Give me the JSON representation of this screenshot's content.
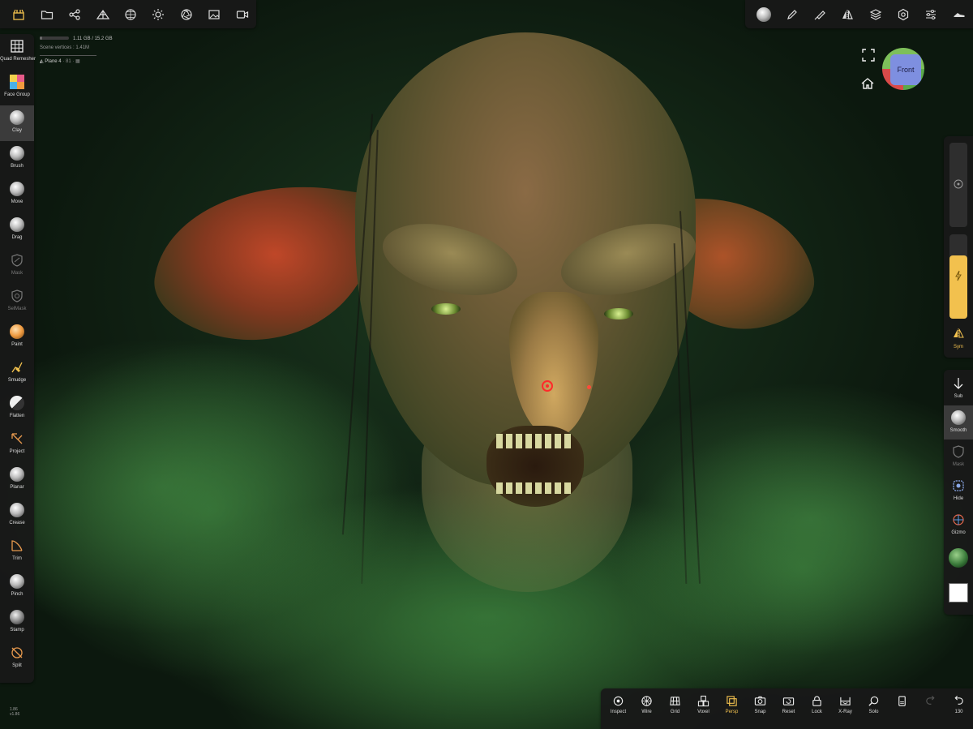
{
  "app": {
    "accent_color": "#f2c14e"
  },
  "top_left_toolbar": {
    "icons": [
      "scene-icon",
      "folder-icon",
      "scene-graph-icon",
      "topology-icon",
      "material-sphere-icon",
      "light-icon",
      "camera-aperture-icon",
      "image-icon",
      "video-icon"
    ]
  },
  "top_right_toolbar": {
    "icons": [
      "material-preview-icon",
      "brush-pencil-icon",
      "stroke-icon",
      "symmetry-icon",
      "layers-icon",
      "settings-gear-icon",
      "sliders-icon",
      "shoe-icon"
    ]
  },
  "info": {
    "memory": "1.11 GB / 15.2 GB",
    "memory_fraction": 0.07,
    "vertices": "Scene vertices : 1.41M",
    "object": "Plane 4",
    "object_suffix": "· 81 · ▦"
  },
  "left_tools": [
    {
      "label": "Quad Remesher",
      "icon": "grid-icon"
    },
    {
      "label": "Face Group",
      "icon": "face-group-icon"
    },
    {
      "label": "Clay",
      "icon": "clay-sphere-icon"
    },
    {
      "label": "Brush",
      "icon": "brush-sphere-icon"
    },
    {
      "label": "Move",
      "icon": "move-sphere-icon"
    },
    {
      "label": "Drag",
      "icon": "drag-sphere-icon"
    },
    {
      "label": "Mask",
      "icon": "mask-shield-icon"
    },
    {
      "label": "SelMask",
      "icon": "selmask-shield-icon"
    },
    {
      "label": "Paint",
      "icon": "paint-sphere-icon"
    },
    {
      "label": "Smudge",
      "icon": "smudge-icon"
    },
    {
      "label": "Flatten",
      "icon": "flatten-sphere-icon"
    },
    {
      "label": "Project",
      "icon": "project-icon"
    },
    {
      "label": "Planar",
      "icon": "planar-sphere-icon"
    },
    {
      "label": "Crease",
      "icon": "crease-sphere-icon"
    },
    {
      "label": "Trim",
      "icon": "trim-icon"
    },
    {
      "label": "Pinch",
      "icon": "pinch-sphere-icon"
    },
    {
      "label": "Stamp",
      "icon": "stamp-sphere-icon"
    },
    {
      "label": "Split",
      "icon": "split-icon"
    }
  ],
  "version": {
    "line1": "1.86",
    "line2": "v1.86"
  },
  "view": {
    "cube_label": "Front"
  },
  "right_panel": {
    "radius_fraction": 0.5,
    "intensity_fraction": 0.75,
    "sym_label": "Sym",
    "tools": [
      {
        "label": "Sub",
        "icon": "sub-arrow-icon"
      },
      {
        "label": "Smooth",
        "icon": "smooth-icon"
      },
      {
        "label": "Mask",
        "icon": "mask-shield-icon"
      },
      {
        "label": "Hide",
        "icon": "hide-icon"
      },
      {
        "label": "Gizmo",
        "icon": "gizmo-icon"
      }
    ]
  },
  "bottom_bar": {
    "buttons": [
      {
        "label": "Inspect",
        "icon": "inspect-icon"
      },
      {
        "label": "Wire",
        "icon": "wire-icon"
      },
      {
        "label": "Grid",
        "icon": "grid-icon"
      },
      {
        "label": "Voxel",
        "icon": "voxel-icon"
      },
      {
        "label": "Persp",
        "icon": "persp-icon"
      },
      {
        "label": "Snap",
        "icon": "snap-camera-icon"
      },
      {
        "label": "Reset",
        "icon": "reset-camera-icon"
      },
      {
        "label": "Lock",
        "icon": "lock-icon"
      },
      {
        "label": "X-Ray",
        "icon": "xray-icon"
      },
      {
        "label": "Solo",
        "icon": "solo-search-icon"
      },
      {
        "label": "",
        "icon": "history-icon"
      },
      {
        "label": "",
        "icon": "redo-icon"
      },
      {
        "label": "130",
        "icon": "undo-icon"
      }
    ]
  }
}
